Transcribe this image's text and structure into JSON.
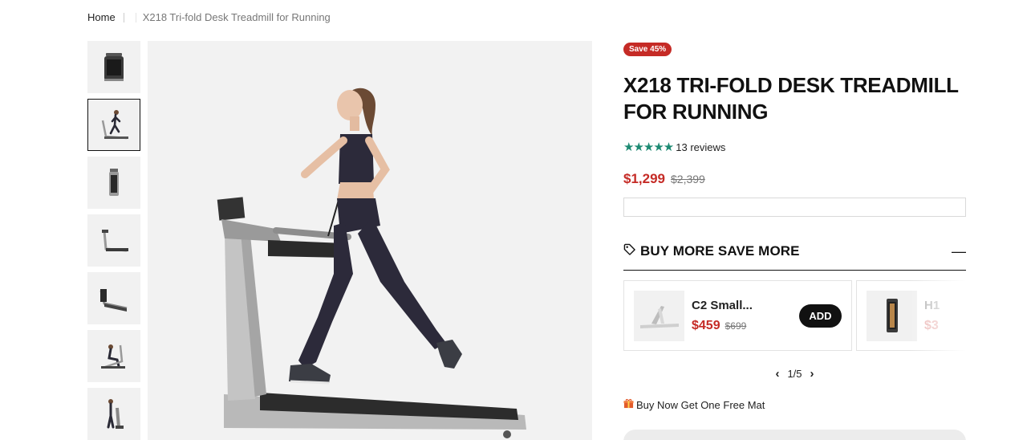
{
  "breadcrumb": {
    "home": "Home",
    "current": "X218 Tri-fold Desk Treadmill for Running"
  },
  "thumbnails": [
    {
      "icon": "treadmill-folded-front-icon"
    },
    {
      "icon": "woman-running-icon",
      "active": true
    },
    {
      "icon": "treadmill-upright-icon"
    },
    {
      "icon": "treadmill-side-icon"
    },
    {
      "icon": "treadmill-angled-icon"
    },
    {
      "icon": "woman-sitting-treadmill-icon"
    },
    {
      "icon": "woman-standing-treadmill-icon"
    }
  ],
  "product": {
    "badge": "Save 45%",
    "title": "X218 TRI-FOLD DESK TREADMILL FOR RUNNING",
    "stars": "★★★★★",
    "rating_value": 5,
    "reviews": "13 reviews",
    "price": "$1,299",
    "compare_price": "$2,399"
  },
  "bundle": {
    "title": "BUY MORE SAVE MORE",
    "collapse_icon": "minus-icon",
    "items": [
      {
        "name": "C2 Small...",
        "price": "$459",
        "compare_price": "$699",
        "button": "ADD"
      },
      {
        "name": "H1",
        "price": "$3"
      }
    ],
    "pager": "1/5",
    "prev": "‹",
    "next": "›"
  },
  "promo": {
    "icon": "gift-icon",
    "text": "Buy Now Get One Free Mat"
  },
  "colors": {
    "accent_red": "#c52b26",
    "star_green": "#1d8a72",
    "button_dark": "#111111"
  }
}
